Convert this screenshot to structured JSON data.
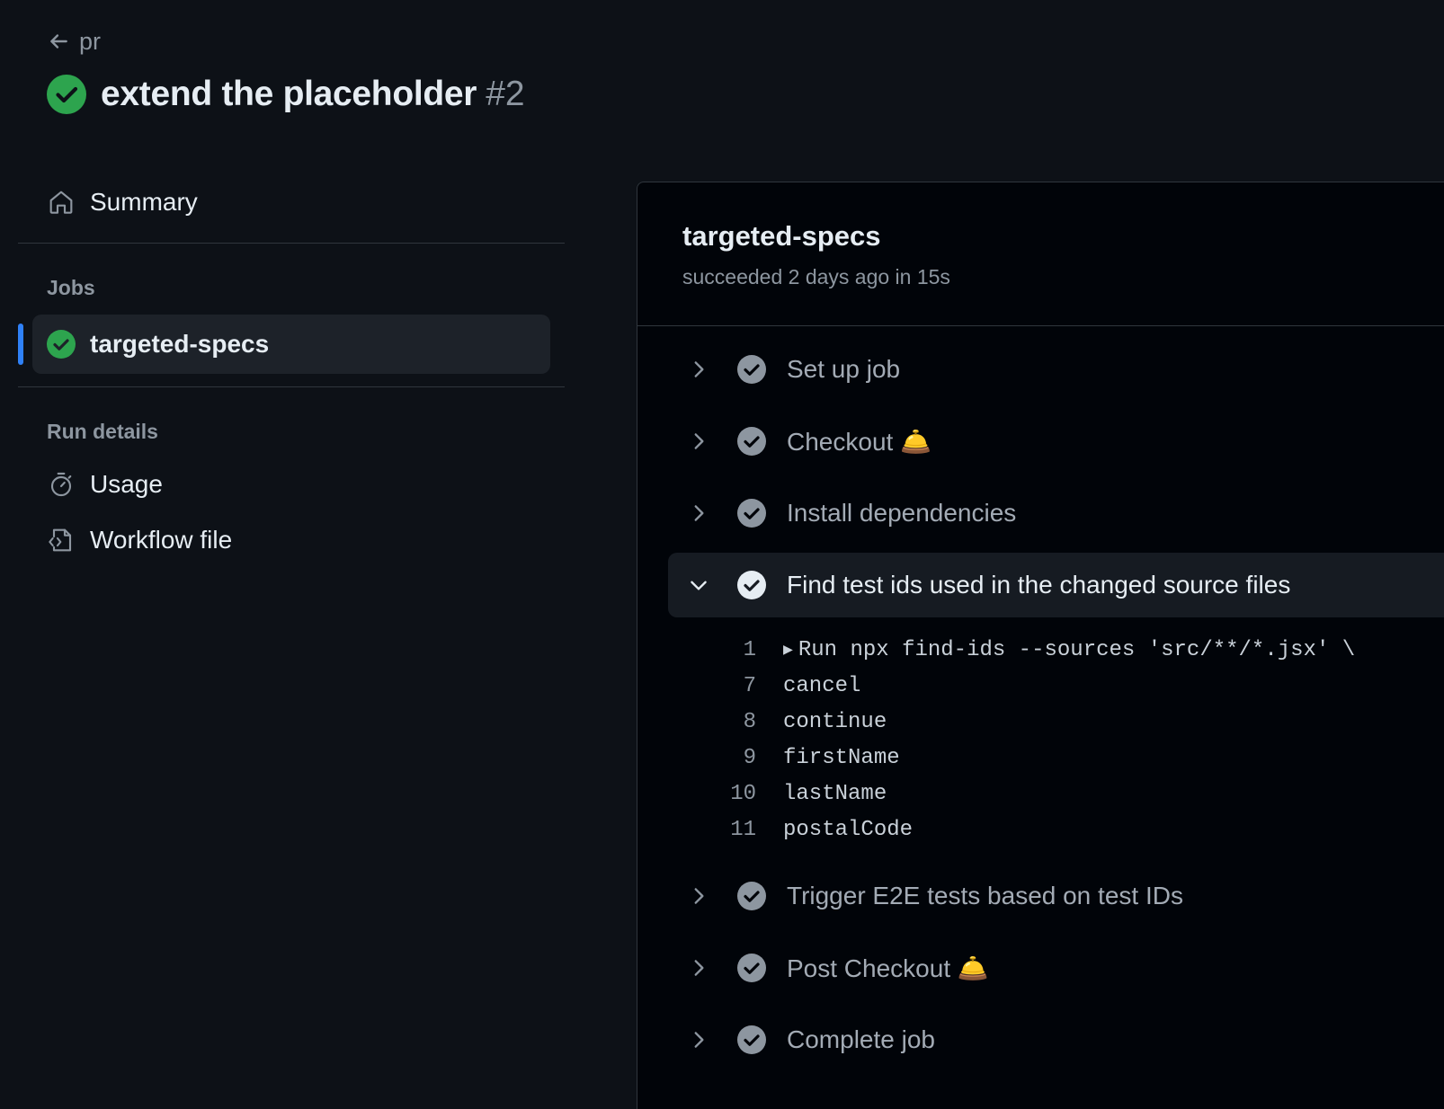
{
  "header": {
    "back_label": "pr",
    "title": "extend the placeholder",
    "run_number": "#2"
  },
  "sidebar": {
    "summary_label": "Summary",
    "jobs_heading": "Jobs",
    "job_name": "targeted-specs",
    "run_details_heading": "Run details",
    "usage_label": "Usage",
    "workflow_file_label": "Workflow file"
  },
  "panel": {
    "job_name": "targeted-specs",
    "job_status": "succeeded 2 days ago in 15s",
    "steps": [
      {
        "label": "Set up job"
      },
      {
        "label": "Checkout 🛎️"
      },
      {
        "label": "Install dependencies"
      },
      {
        "label": "Find test ids used in the changed source files"
      },
      {
        "label": "Trigger E2E tests based on test IDs"
      },
      {
        "label": "Post Checkout 🛎️"
      },
      {
        "label": "Complete job"
      }
    ],
    "log_lines": [
      {
        "n": "1",
        "text": "Run npx find-ids --sources 'src/**/*.jsx' \\"
      },
      {
        "n": "7",
        "text": "cancel"
      },
      {
        "n": "8",
        "text": "continue"
      },
      {
        "n": "9",
        "text": "firstName"
      },
      {
        "n": "10",
        "text": "lastName"
      },
      {
        "n": "11",
        "text": "postalCode"
      }
    ]
  },
  "colors": {
    "success": "#2da44e",
    "accent": "#2f81f7",
    "background": "#0d1117",
    "panel_background": "#010409"
  }
}
